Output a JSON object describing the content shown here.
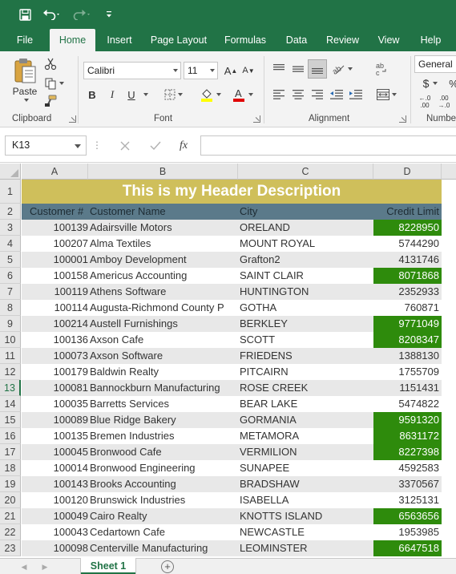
{
  "qat": {
    "save_icon": "save-icon",
    "undo_icon": "undo-icon",
    "redo_icon": "redo-icon",
    "customize_icon": "customize-qat-icon"
  },
  "tabs": [
    "File",
    "Home",
    "Insert",
    "Page Layout",
    "Formulas",
    "Data",
    "Review",
    "View",
    "Help"
  ],
  "active_tab": "Home",
  "ribbon": {
    "clipboard": {
      "label": "Clipboard",
      "paste_label": "Paste"
    },
    "font": {
      "label": "Font",
      "font_name": "Calibri",
      "font_size": "11",
      "bold": "B",
      "italic": "I",
      "underline": "U",
      "font_color": "#e00000",
      "fill_color": "#ffff00"
    },
    "alignment": {
      "label": "Alignment"
    },
    "number": {
      "label": "Numbe",
      "format": "General",
      "currency": "$",
      "percent": "%"
    }
  },
  "formula_bar": {
    "name_box": "K13",
    "fx": "fx",
    "formula": ""
  },
  "columns": [
    "A",
    "B",
    "C",
    "D"
  ],
  "header_description": "This is my Header Description",
  "table_headers": {
    "a": "Customer #",
    "b": "Customer Name",
    "c": "City",
    "d": "Credit Limit"
  },
  "rows": [
    {
      "n": "3",
      "id": "100139",
      "name": "Adairsville Motors",
      "city": "ORELAND",
      "limit": "8228950",
      "hl": true
    },
    {
      "n": "4",
      "id": "100207",
      "name": "Alma Textiles",
      "city": "MOUNT ROYAL",
      "limit": "5744290",
      "hl": false
    },
    {
      "n": "5",
      "id": "100001",
      "name": "Amboy Development",
      "city": "Grafton2",
      "limit": "4131746",
      "hl": false
    },
    {
      "n": "6",
      "id": "100158",
      "name": "Americus Accounting",
      "city": "SAINT CLAIR",
      "limit": "8071868",
      "hl": true
    },
    {
      "n": "7",
      "id": "100119",
      "name": "Athens Software",
      "city": "HUNTINGTON",
      "limit": "2352933",
      "hl": false
    },
    {
      "n": "8",
      "id": "100114",
      "name": "Augusta-Richmond County P",
      "city": "GOTHA",
      "limit": "760871",
      "hl": false
    },
    {
      "n": "9",
      "id": "100214",
      "name": "Austell Furnishings",
      "city": "BERKLEY",
      "limit": "9771049",
      "hl": true
    },
    {
      "n": "10",
      "id": "100136",
      "name": "Axson Cafe",
      "city": "SCOTT",
      "limit": "8208347",
      "hl": true
    },
    {
      "n": "11",
      "id": "100073",
      "name": "Axson Software",
      "city": "FRIEDENS",
      "limit": "1388130",
      "hl": false
    },
    {
      "n": "12",
      "id": "100179",
      "name": "Baldwin Realty",
      "city": "PITCAIRN",
      "limit": "1755709",
      "hl": false
    },
    {
      "n": "13",
      "id": "100081",
      "name": "Bannockburn Manufacturing",
      "city": "ROSE CREEK",
      "limit": "1151431",
      "hl": false
    },
    {
      "n": "14",
      "id": "100035",
      "name": "Barretts Services",
      "city": "BEAR LAKE",
      "limit": "5474822",
      "hl": false
    },
    {
      "n": "15",
      "id": "100089",
      "name": "Blue Ridge Bakery",
      "city": "GORMANIA",
      "limit": "9591320",
      "hl": true
    },
    {
      "n": "16",
      "id": "100135",
      "name": "Bremen Industries",
      "city": "METAMORA",
      "limit": "8631172",
      "hl": true
    },
    {
      "n": "17",
      "id": "100045",
      "name": "Bronwood Cafe",
      "city": "VERMILION",
      "limit": "8227398",
      "hl": true
    },
    {
      "n": "18",
      "id": "100014",
      "name": "Bronwood Engineering",
      "city": "SUNAPEE",
      "limit": "4592583",
      "hl": false
    },
    {
      "n": "19",
      "id": "100143",
      "name": "Brooks Accounting",
      "city": "BRADSHAW",
      "limit": "3370567",
      "hl": false
    },
    {
      "n": "20",
      "id": "100120",
      "name": "Brunswick Industries",
      "city": "ISABELLA",
      "limit": "3125131",
      "hl": false
    },
    {
      "n": "21",
      "id": "100049",
      "name": "Cairo Realty",
      "city": "KNOTTS ISLAND",
      "limit": "6563656",
      "hl": true
    },
    {
      "n": "22",
      "id": "100043",
      "name": "Cedartown Cafe",
      "city": "NEWCASTLE",
      "limit": "1953985",
      "hl": false
    },
    {
      "n": "23",
      "id": "100098",
      "name": "Centerville Manufacturing",
      "city": "LEOMINSTER",
      "limit": "6647518",
      "hl": true
    }
  ],
  "row_labels": {
    "r1": "1",
    "r2": "2"
  },
  "selected_row": "13",
  "colors": {
    "accent": "#217346",
    "banner": "#cfbf5b",
    "table_header": "#5b7a8a",
    "highlight": "#2e8b0c",
    "stripe": "#e8e8e8"
  },
  "sheet_tab": "Sheet 1"
}
